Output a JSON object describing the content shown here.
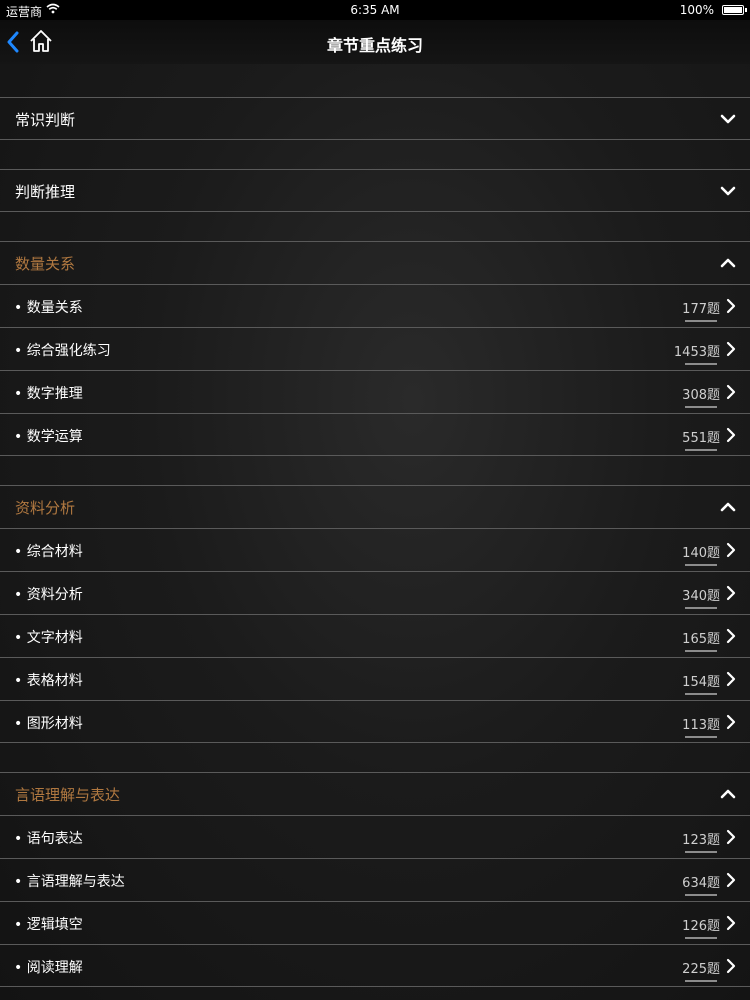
{
  "status_bar": {
    "carrier": "运营商",
    "time": "6:35 AM",
    "battery": "100%"
  },
  "nav": {
    "title": "章节重点练习",
    "back_icon": "chevron-left-icon",
    "home_icon": "home-icon",
    "accent_color": "#1e88ff"
  },
  "colors": {
    "expanded_section_label": "#b07840",
    "divider": "#5a5a5a"
  },
  "sections": [
    {
      "label": "常识判断",
      "expanded": false,
      "items": []
    },
    {
      "label": "判断推理",
      "expanded": false,
      "items": []
    },
    {
      "label": "数量关系",
      "expanded": true,
      "items": [
        {
          "label": "• 数量关系",
          "count": "177题"
        },
        {
          "label": "• 综合强化练习",
          "count": "1453题"
        },
        {
          "label": "• 数字推理",
          "count": "308题"
        },
        {
          "label": "• 数学运算",
          "count": "551题"
        }
      ]
    },
    {
      "label": "资料分析",
      "expanded": true,
      "items": [
        {
          "label": "• 综合材料",
          "count": "140题"
        },
        {
          "label": "• 资料分析",
          "count": "340题"
        },
        {
          "label": "• 文字材料",
          "count": "165题"
        },
        {
          "label": "• 表格材料",
          "count": "154题"
        },
        {
          "label": "• 图形材料",
          "count": "113题"
        }
      ]
    },
    {
      "label": "言语理解与表达",
      "expanded": true,
      "items": [
        {
          "label": "• 语句表达",
          "count": "123题"
        },
        {
          "label": "• 言语理解与表达",
          "count": "634题"
        },
        {
          "label": "• 逻辑填空",
          "count": "126题"
        },
        {
          "label": "• 阅读理解",
          "count": "225题"
        }
      ]
    }
  ]
}
